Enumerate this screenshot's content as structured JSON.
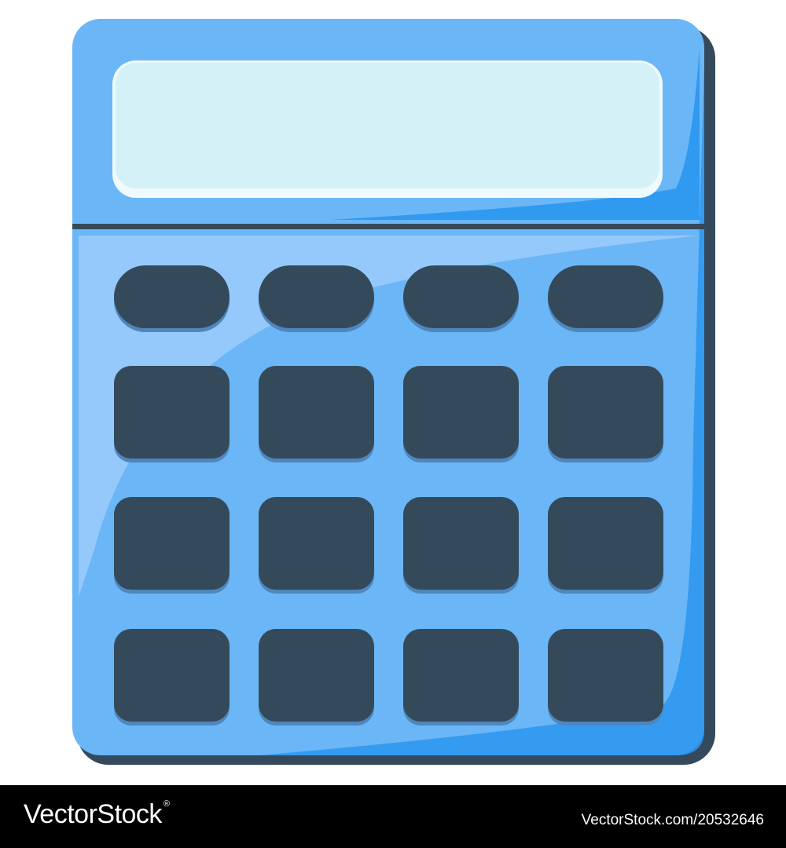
{
  "illustration": {
    "subject": "calculator-icon",
    "colors": {
      "body": "#6bb6f6",
      "body_shadow": "#35495c",
      "body_edge_dark": "#2a96f0",
      "body_highlight": "#9ccdfb",
      "display": "#d5f1f8",
      "display_rim": "#eefafd",
      "key": "#344a5b",
      "key_shadow": "#4f87bd",
      "divider": "#344a5b"
    },
    "key_rows": [
      {
        "shape": "pill",
        "count": 4
      },
      {
        "shape": "square",
        "count": 4
      },
      {
        "shape": "square",
        "count": 4
      },
      {
        "shape": "square",
        "count": 4
      }
    ]
  },
  "watermark": {
    "logo_text": "VectorStock",
    "logo_mark": "®",
    "stock_id": "VectorStock.com/20532646",
    "background": "#000000",
    "text_color": "#ffffff"
  }
}
